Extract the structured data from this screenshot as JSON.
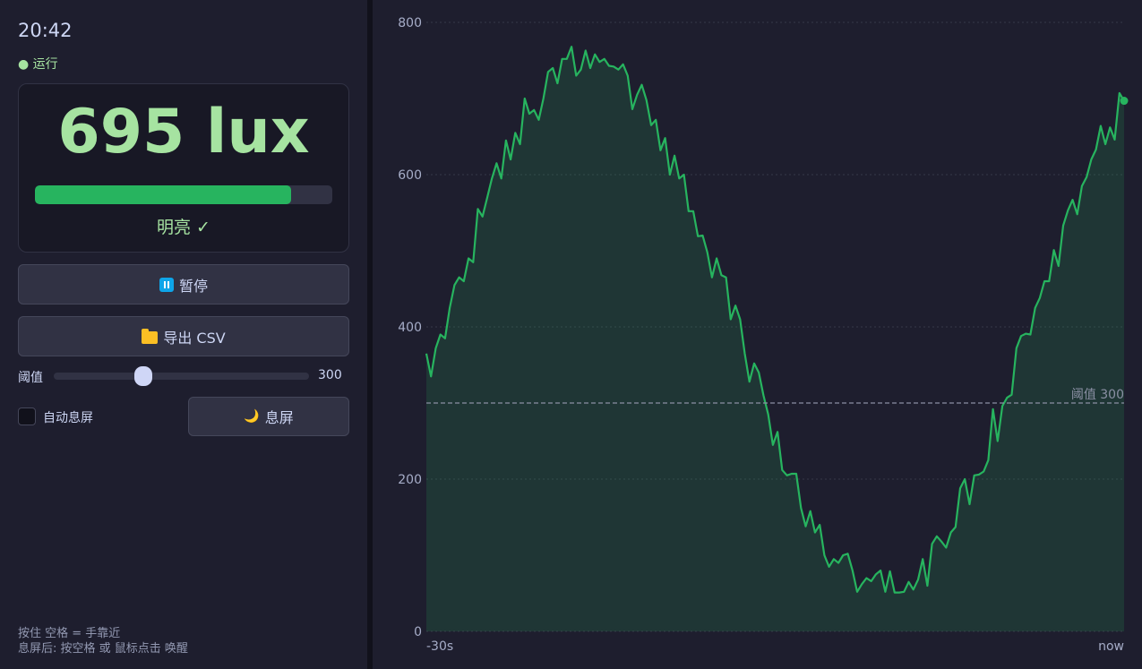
{
  "clock": "20:42",
  "status": "● 运行",
  "reading": {
    "value": "695 lux",
    "level": 0.86,
    "state": "明亮 ✓"
  },
  "buttons": {
    "pause": "暂停",
    "export": "导出 CSV",
    "sleep": "息屏"
  },
  "threshold": {
    "label": "阈值",
    "value": "300",
    "position": 0.35
  },
  "auto_sleep": {
    "label": "自动息屏",
    "checked": false
  },
  "hints": {
    "line1": "按住 空格 = 手靠近",
    "line2": "息屏后: 按空格 或 鼠标点击 唤醒"
  },
  "colors": {
    "accent": "#a6e3a1",
    "line": "#27b45f",
    "bg": "#1e1e2e"
  },
  "chart_data": {
    "type": "area",
    "y_ticks": [
      "0",
      "200",
      "400",
      "600",
      "800"
    ],
    "ylim": [
      0,
      800
    ],
    "x_labels": {
      "start": "-30s",
      "end": "now"
    },
    "threshold_line": {
      "value": 300,
      "label": "阈值 300"
    },
    "grid": true,
    "values": [
      365,
      335,
      372,
      390,
      385,
      425,
      455,
      465,
      460,
      490,
      485,
      555,
      545,
      570,
      595,
      615,
      595,
      645,
      620,
      655,
      640,
      700,
      680,
      685,
      672,
      700,
      735,
      740,
      720,
      752,
      752,
      768,
      730,
      738,
      763,
      740,
      758,
      748,
      752,
      743,
      742,
      738,
      745,
      730,
      686,
      705,
      718,
      698,
      665,
      672,
      632,
      648,
      600,
      625,
      595,
      600,
      552,
      552,
      519,
      520,
      498,
      465,
      490,
      468,
      465,
      410,
      428,
      410,
      365,
      328,
      352,
      340,
      310,
      285,
      245,
      262,
      212,
      205,
      207,
      207,
      162,
      138,
      158,
      130,
      140,
      100,
      85,
      95,
      90,
      100,
      102,
      80,
      52,
      62,
      70,
      66,
      75,
      80,
      52,
      79,
      51,
      51,
      52,
      65,
      55,
      68,
      95,
      60,
      115,
      125,
      118,
      110,
      130,
      137,
      188,
      200,
      167,
      205,
      206,
      210,
      225,
      292,
      250,
      296,
      307,
      311,
      372,
      388,
      391,
      390,
      425,
      438,
      460,
      460,
      501,
      480,
      533,
      553,
      567,
      548,
      585,
      597,
      620,
      633,
      664,
      640,
      662,
      646,
      707,
      697
    ]
  }
}
